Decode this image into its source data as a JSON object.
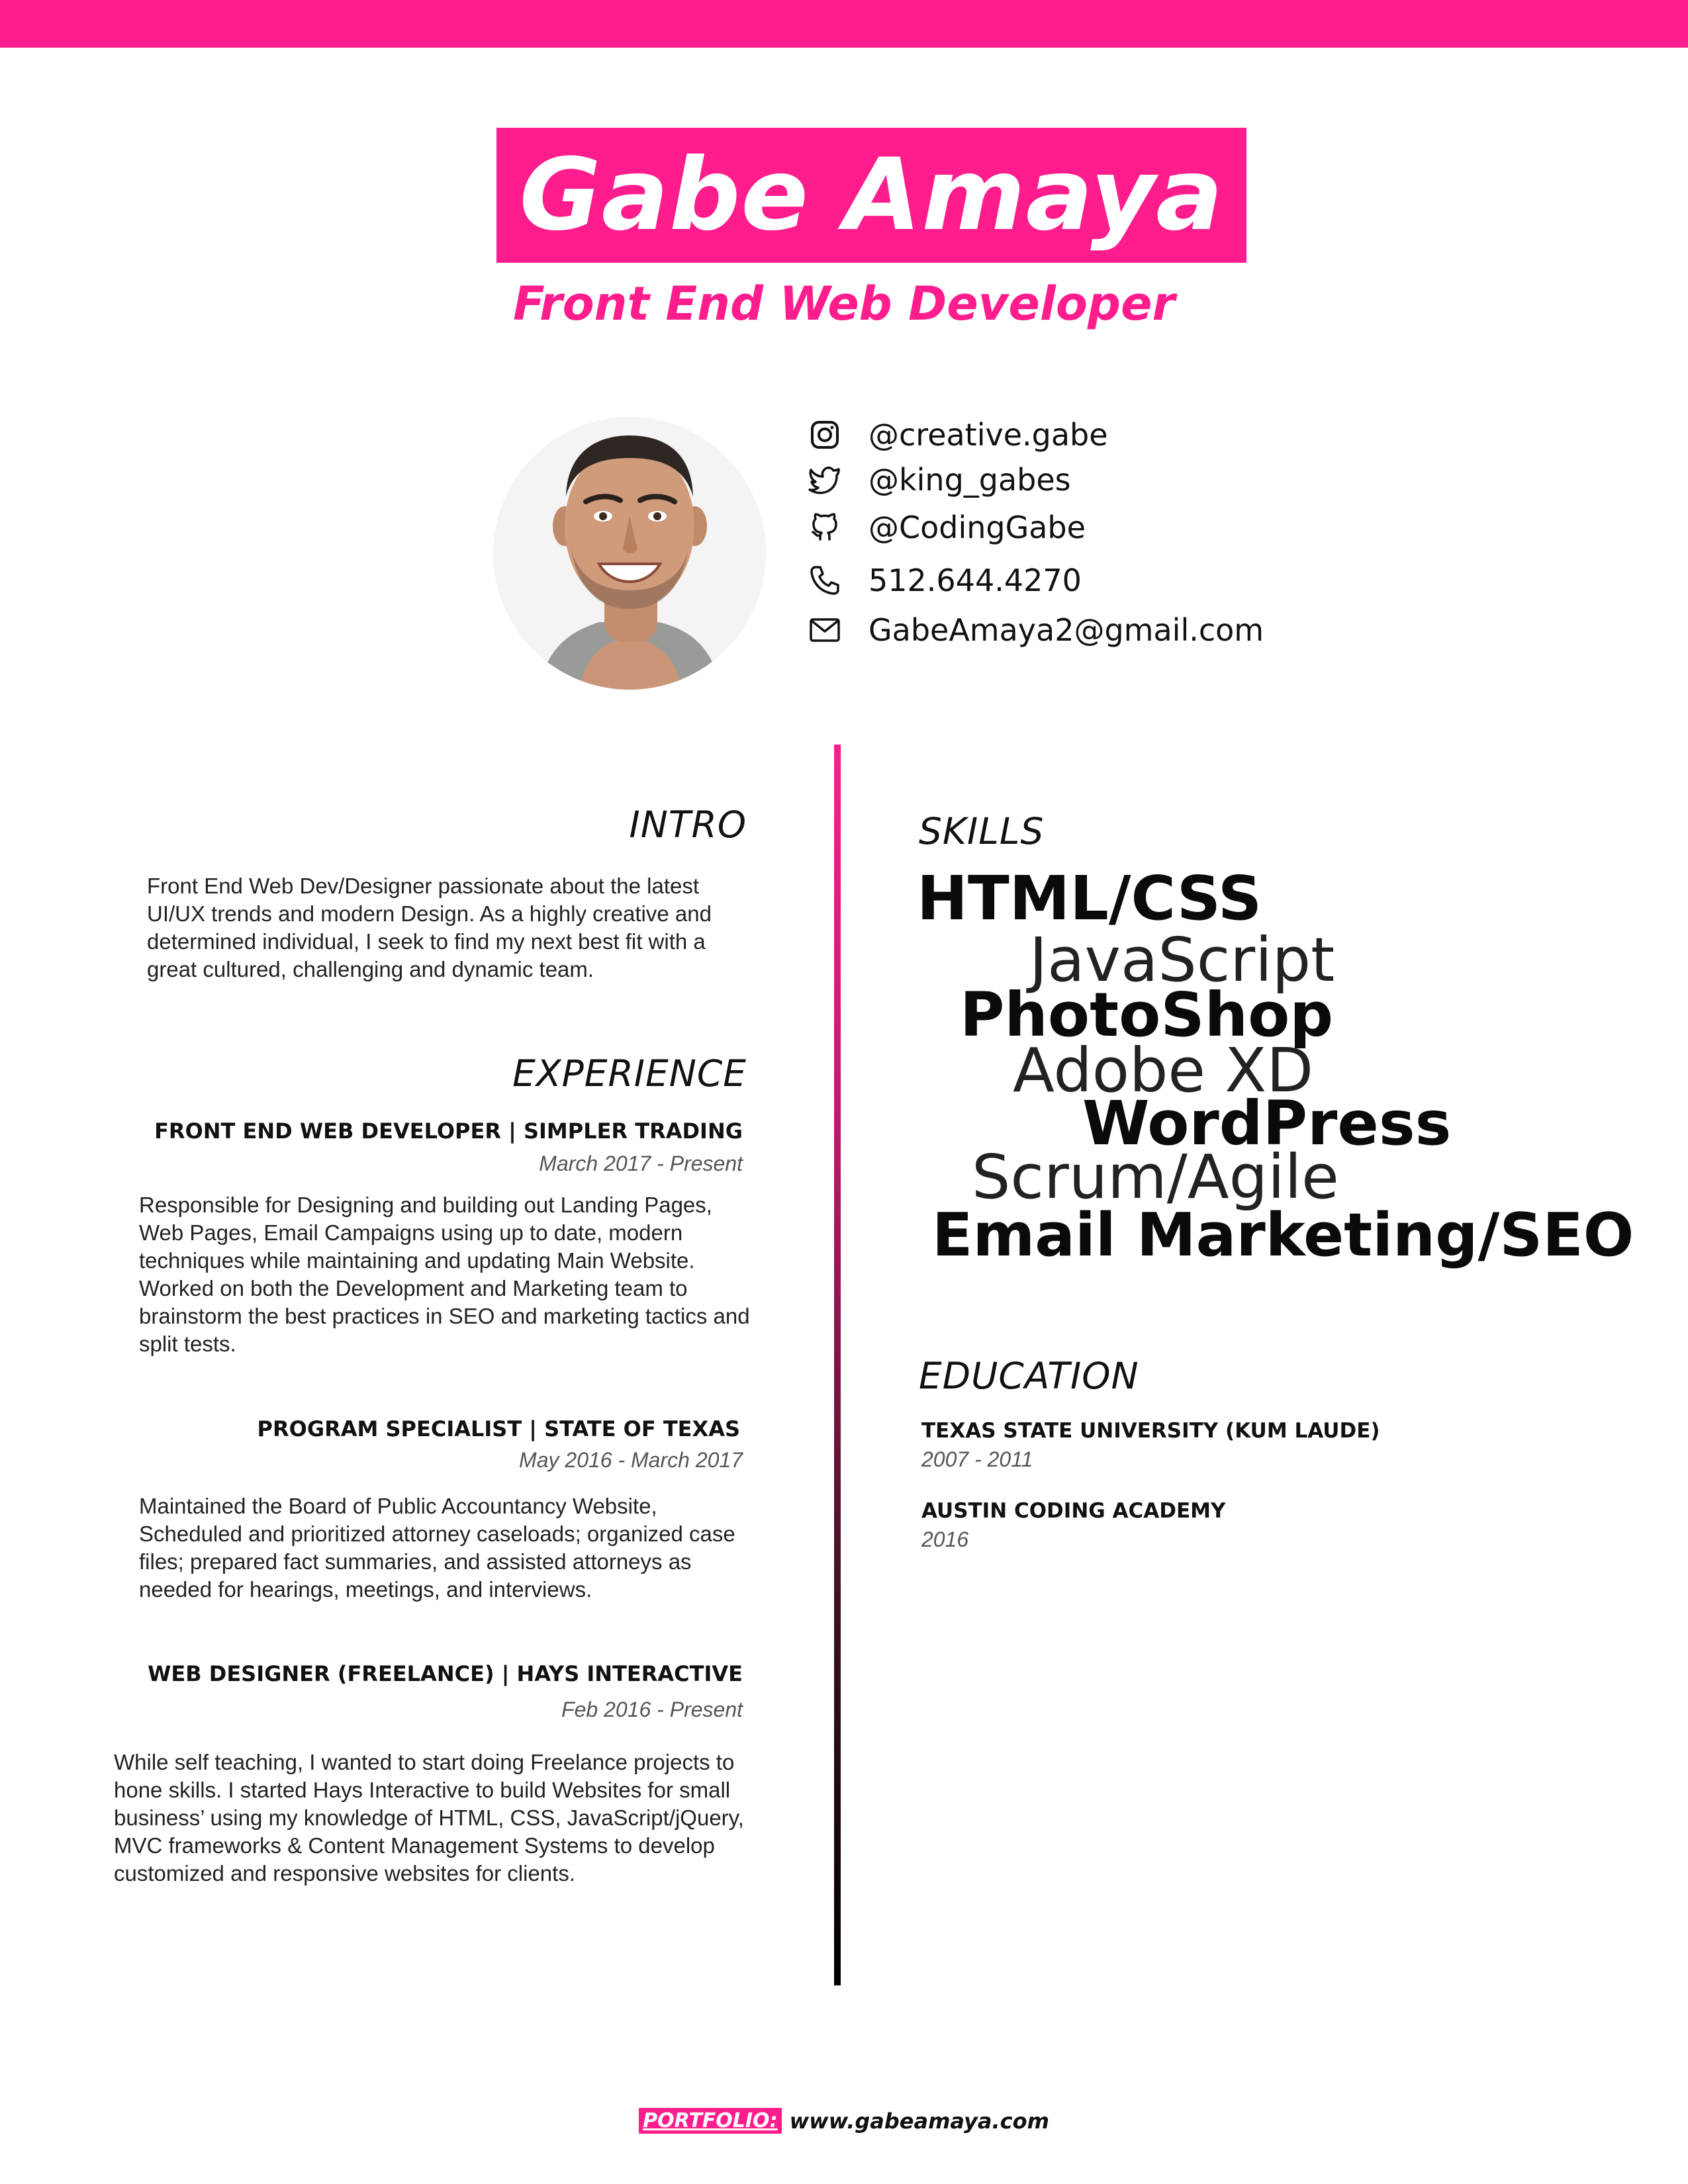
{
  "header": {
    "name": "Gabe Amaya",
    "title": "Front End Web Developer",
    "accent_color": "#ff1d8d"
  },
  "contacts": [
    {
      "icon": "instagram-icon",
      "text": "@creative.gabe"
    },
    {
      "icon": "twitter-icon",
      "text": "@king_gabes"
    },
    {
      "icon": "github-icon",
      "text": "@CodingGabe"
    },
    {
      "icon": "phone-icon",
      "text": "512.644.4270"
    },
    {
      "icon": "mail-icon",
      "text": "GabeAmaya2@gmail.com"
    }
  ],
  "intro": {
    "heading": "INTRO",
    "text": "Front End Web Dev/Designer passionate about the latest UI/UX trends and modern Design. As a highly creative and determined individual, I seek to find my next best fit with a great cultured, challenging and dynamic team."
  },
  "experience": {
    "heading": "EXPERIENCE",
    "jobs": [
      {
        "title": "FRONT END WEB DEVELOPER | SIMPLER TRADING",
        "dates": "March 2017 - Present",
        "description": "Responsible for Designing and building out Landing Pages, Web Pages, Email Campaigns using up to date, modern techniques while maintaining and updating Main Website. Worked on both the Development and Marketing team to brainstorm the best practices in SEO and marketing tactics and split tests."
      },
      {
        "title": "PROGRAM SPECIALIST | STATE OF TEXAS",
        "dates": "May 2016 - March 2017",
        "description": "Maintained the Board of Public Accountancy Website, Scheduled and prioritized attorney caseloads; organized case files; prepared fact summaries, and assisted attorneys as needed for hearings,  meetings, and interviews."
      },
      {
        "title": "WEB DESIGNER (FREELANCE) | HAYS INTERACTIVE",
        "dates": "Feb 2016 - Present",
        "description": "While self teaching, I wanted to start doing Freelance projects to hone skills. I started Hays Interactive to build Websites for small business’ using my knowledge of HTML, CSS, JavaScript/jQuery, MVC frameworks & Content Management Systems to develop customized and responsive websites for clients."
      }
    ]
  },
  "skills": {
    "heading": "SKILLS",
    "items": [
      "HTML/CSS",
      "JavaScript",
      "PhotoShop",
      "Adobe XD",
      "WordPress",
      "Scrum/Agile",
      "Email Marketing/SEO"
    ]
  },
  "education": {
    "heading": "EDUCATION",
    "items": [
      {
        "school": "TEXAS STATE UNIVERSITY (KUM LAUDE)",
        "years": "2007 - 2011"
      },
      {
        "school": "AUSTIN CODING ACADEMY",
        "years": "2016"
      }
    ]
  },
  "footer": {
    "label": "PORTFOLIO:",
    "url": "www.gabeamaya.com"
  }
}
